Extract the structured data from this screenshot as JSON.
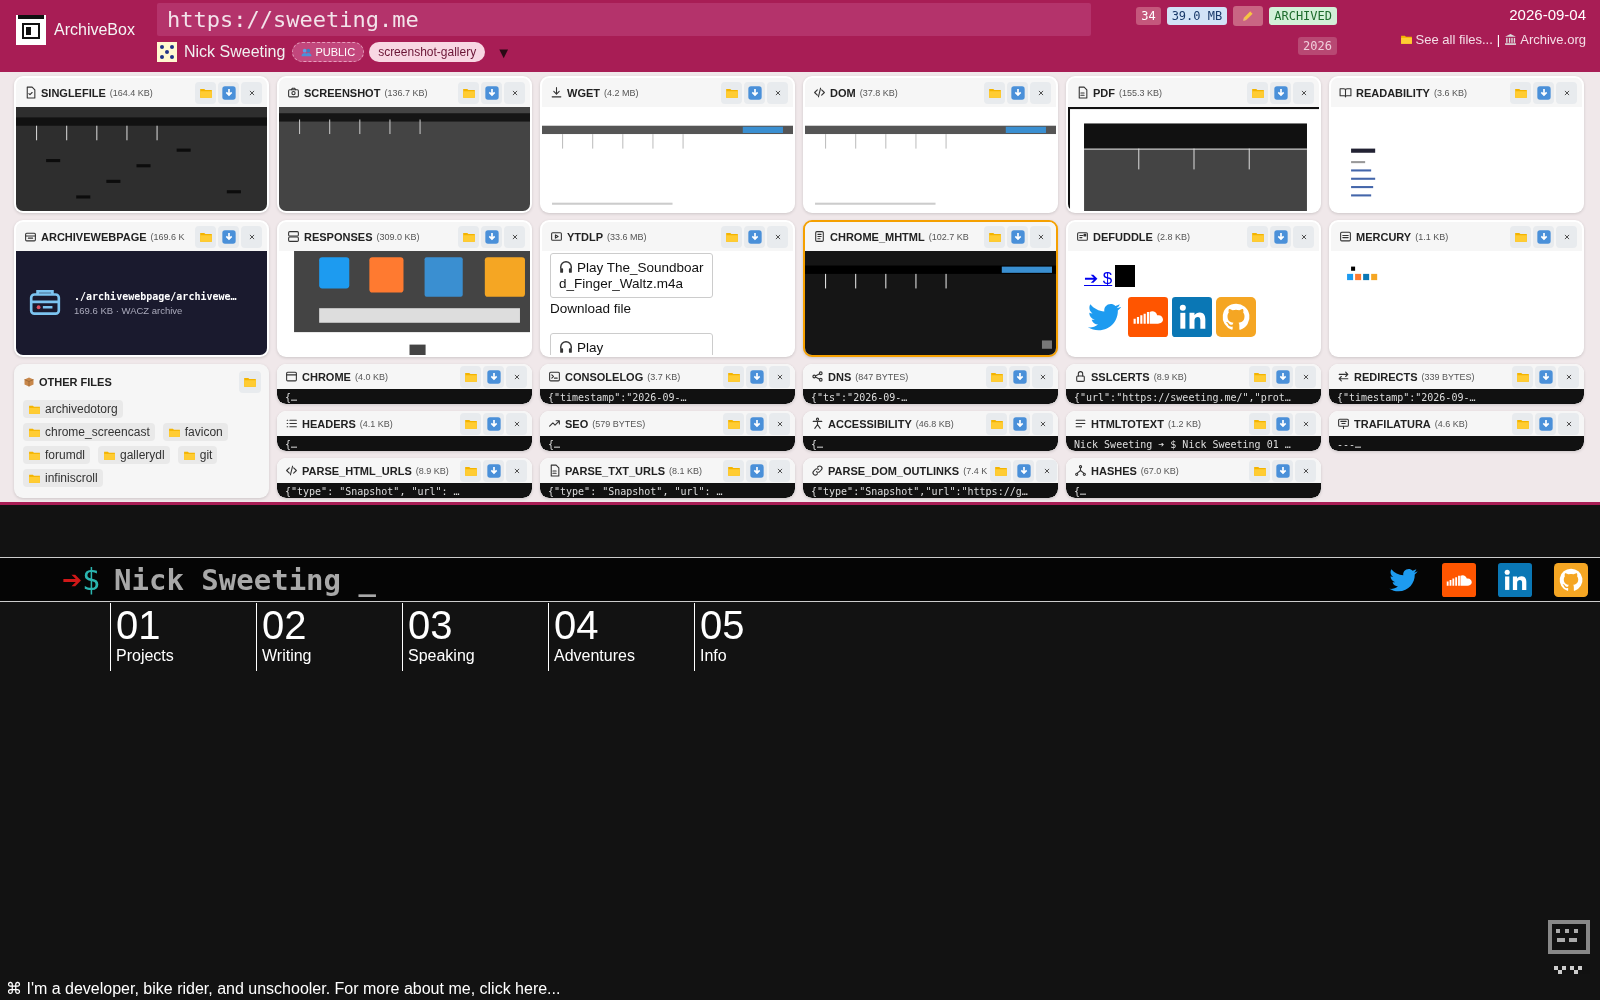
{
  "header": {
    "app_name": "ArchiveBox",
    "url": "https://sweeting.me",
    "title": "Nick Sweeting",
    "visibility": "PUBLIC",
    "tag": "screenshot-gallery",
    "menu_caret": "▼",
    "file_count": "34",
    "total_size": "39.0 MB",
    "status": "ARCHIVED",
    "year": "2026",
    "date": "2026-09-04",
    "see_all": "See all files...",
    "separator": "|",
    "archive_org": "Archive.org"
  },
  "artifacts": [
    {
      "name": "SINGLEFILE",
      "size": "(164.4 KB)",
      "selected": false,
      "kind": "picture"
    },
    {
      "name": "SCREENSHOT",
      "size": "(136.7 KB)",
      "selected": false,
      "kind": "picture"
    },
    {
      "name": "WGET",
      "size": "(4.2 MB)",
      "selected": false,
      "kind": "picture"
    },
    {
      "name": "DOM",
      "size": "(37.8 KB)",
      "selected": false,
      "kind": "picture"
    },
    {
      "name": "PDF",
      "size": "(155.3 KB)",
      "selected": false,
      "kind": "picture"
    },
    {
      "name": "READABILITY",
      "size": "(3.6 KB)",
      "selected": false,
      "kind": "picture"
    },
    {
      "name": "ARCHIVEWEBPAGE",
      "size": "(169.6 K",
      "selected": false,
      "kind": "file",
      "path": "./archivewebpage/archivewe…",
      "meta": "169.6 KB · WACZ archive"
    },
    {
      "name": "RESPONSES",
      "size": "(309.0 KB)",
      "selected": false,
      "kind": "picture"
    },
    {
      "name": "YTDLP",
      "size": "(33.6 MB)",
      "selected": false,
      "kind": "audio",
      "tracks": [
        "Play The_Soundboard_Finger_Waltz.m4a",
        "Play"
      ],
      "download": "Download file"
    },
    {
      "name": "CHROME_MHTML",
      "size": "(102.7 KB",
      "selected": true,
      "kind": "picture"
    },
    {
      "name": "DEFUDDLE",
      "size": "(2.8 KB)",
      "selected": false,
      "kind": "links",
      "link": "➔ $"
    },
    {
      "name": "MERCURY",
      "size": "(1.1 KB)",
      "selected": false,
      "kind": "picture"
    }
  ],
  "other_files": {
    "title": "OTHER FILES",
    "folders": [
      "archivedotorg",
      "chrome_screencast",
      "favicon",
      "forumdl",
      "gallerydl",
      "git",
      "infiniscroll"
    ]
  },
  "outputs": [
    {
      "name": "CHROME",
      "size": "(4.0 KB)",
      "preview": "{…"
    },
    {
      "name": "CONSOLELOG",
      "size": "(3.7 KB)",
      "preview": "{\"timestamp\":\"2026-09-…"
    },
    {
      "name": "DNS",
      "size": "(847 BYTES)",
      "preview": "{\"ts\":\"2026-09-…"
    },
    {
      "name": "SSLCERTS",
      "size": "(8.9 KB)",
      "preview": "{\"url\":\"https://sweeting.me/\",\"prot…"
    },
    {
      "name": "REDIRECTS",
      "size": "(339 BYTES)",
      "preview": "{\"timestamp\":\"2026-09-…"
    },
    {
      "name": "HEADERS",
      "size": "(4.1 KB)",
      "preview": "{…"
    },
    {
      "name": "SEO",
      "size": "(579 BYTES)",
      "preview": "{…"
    },
    {
      "name": "ACCESSIBILITY",
      "size": "(46.8 KB)",
      "preview": "{…"
    },
    {
      "name": "HTMLTOTEXT",
      "size": "(1.2 KB)",
      "preview": "Nick Sweeting ➔ $ Nick Sweeting 01 …"
    },
    {
      "name": "TRAFILATURA",
      "size": "(4.6 KB)",
      "preview": "---…"
    },
    {
      "name": "PARSE_HTML_URLS",
      "size": "(8.9 KB)",
      "preview": "{\"type\": \"Snapshot\", \"url\": …"
    },
    {
      "name": "PARSE_TXT_URLS",
      "size": "(8.1 KB)",
      "preview": "{\"type\": \"Snapshot\", \"url\": …"
    },
    {
      "name": "PARSE_DOM_OUTLINKS",
      "size": "(7.4 K",
      "preview": "{\"type\":\"Snapshot\",\"url\":\"https://g…"
    },
    {
      "name": "HASHES",
      "size": "(67.0 KB)",
      "preview": "{…"
    }
  ],
  "site_preview": {
    "arrow": "➔",
    "prompt": "$",
    "name": "Nick Sweeting _",
    "nav": [
      {
        "number": "01",
        "label": "Projects"
      },
      {
        "number": "02",
        "label": "Writing"
      },
      {
        "number": "03",
        "label": "Speaking"
      },
      {
        "number": "04",
        "label": "Adventures"
      },
      {
        "number": "05",
        "label": "Info"
      }
    ],
    "footer": "⌘ I'm a developer, bike rider, and unschooler. For more about me, click here..."
  }
}
